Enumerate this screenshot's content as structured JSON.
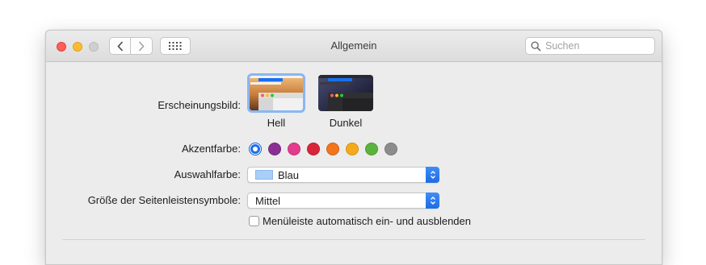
{
  "window": {
    "title": "Allgemein",
    "search_placeholder": "Suchen"
  },
  "appearance": {
    "label": "Erscheinungsbild:",
    "options": [
      {
        "label": "Hell",
        "selected": true
      },
      {
        "label": "Dunkel",
        "selected": false
      }
    ]
  },
  "accent": {
    "label": "Akzentfarbe:",
    "colors": [
      "#1a6ff0",
      "#8b2f94",
      "#e33b8d",
      "#d9253a",
      "#f2741c",
      "#f5aa1b",
      "#5ab33d",
      "#8c8c8c"
    ],
    "selected_index": 0
  },
  "highlight": {
    "label": "Auswahlfarbe:",
    "value": "Blau",
    "swatch_color": "#a9cff9"
  },
  "sidebar_icons": {
    "label": "Größe der Seitenleistensymbole:",
    "value": "Mittel"
  },
  "menubar": {
    "label": "Menüleiste automatisch ein- und ausblenden",
    "checked": false
  }
}
